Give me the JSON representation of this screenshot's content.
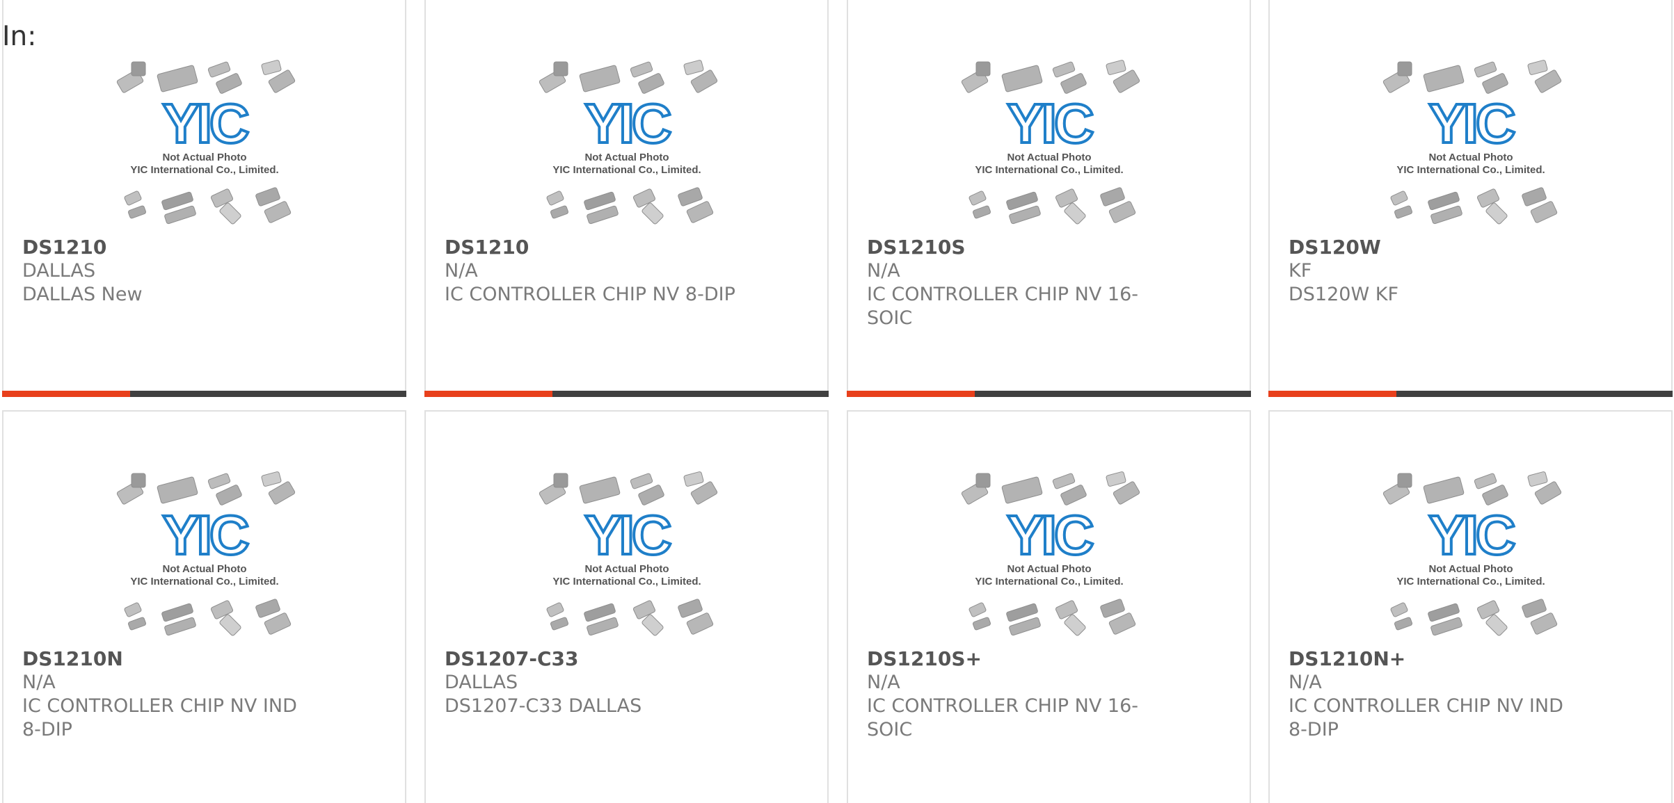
{
  "header": {
    "label": "In:"
  },
  "placeholder": {
    "line1": "Not Actual Photo",
    "line2": "YIC International Co., Limited.",
    "logo_text": "YIC"
  },
  "colors": {
    "accent": "#e8401c",
    "bar_dark": "#404040",
    "logo_blue": "#1f7fc9",
    "chip_gray": "#a8a8a8"
  },
  "products": [
    {
      "part": "DS1210",
      "manufacturer": "DALLAS",
      "description": "DALLAS New"
    },
    {
      "part": "DS1210",
      "manufacturer": "N/A",
      "description": "IC CONTROLLER CHIP NV 8-DIP"
    },
    {
      "part": "DS1210S",
      "manufacturer": "N/A",
      "description": "IC CONTROLLER CHIP NV 16-SOIC"
    },
    {
      "part": "DS120W",
      "manufacturer": "KF",
      "description": "DS120W KF"
    },
    {
      "part": "DS1210N",
      "manufacturer": "N/A",
      "description": "IC CONTROLLER CHIP NV IND 8-DIP"
    },
    {
      "part": "DS1207-C33",
      "manufacturer": "DALLAS",
      "description": "DS1207-C33 DALLAS"
    },
    {
      "part": "DS1210S+",
      "manufacturer": "N/A",
      "description": "IC CONTROLLER CHIP NV 16-SOIC"
    },
    {
      "part": "DS1210N+",
      "manufacturer": "N/A",
      "description": "IC CONTROLLER CHIP NV IND 8-DIP"
    }
  ]
}
